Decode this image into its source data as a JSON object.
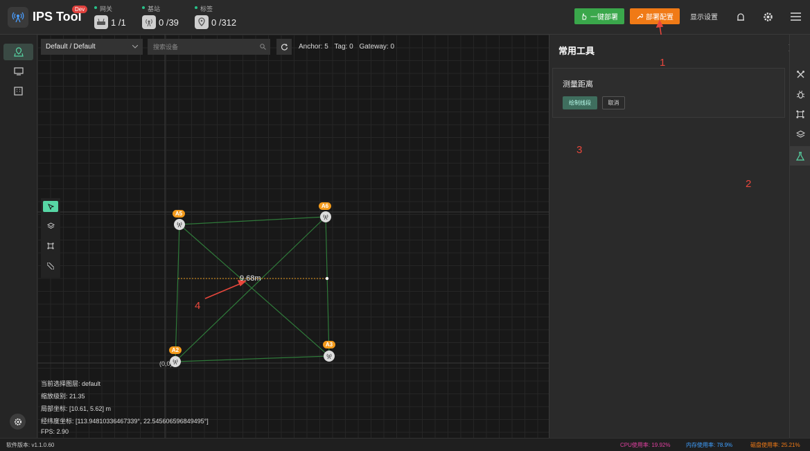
{
  "header": {
    "title": "IPS Tool",
    "badge": "Dev",
    "stats": [
      {
        "label": "网关",
        "value": "1 /1"
      },
      {
        "label": "基站",
        "value": "0 /39"
      },
      {
        "label": "标签",
        "value": "0 /312"
      }
    ],
    "buttons": {
      "deploy": "一键部署",
      "config": "部署配置",
      "display": "显示设置"
    }
  },
  "toolbar": {
    "select_value": "Default / Default",
    "search_placeholder": "搜索设备",
    "counts": {
      "anchor": "Anchor: 5",
      "tag": "Tag: 0",
      "gateway": "Gateway: 0"
    }
  },
  "canvas": {
    "anchors": [
      {
        "label": "A5"
      },
      {
        "label": "A6"
      },
      {
        "label": "A2"
      },
      {
        "label": "A3"
      }
    ],
    "origin_label": "(0,0)",
    "measure_label": "9.68m"
  },
  "info": {
    "layer": "当前选择图层: default",
    "zoom": "缩放级别: 21.35",
    "local": "局部坐标: [10.61, 5.62] m",
    "geo": "经纬度坐标: [113.94810336467339°, 22.545606596849495°]",
    "fps": "FPS: 2.90"
  },
  "panel": {
    "title": "常用工具",
    "card_title": "测量距离",
    "draw_button": "绘制线段",
    "cancel_button": "取消"
  },
  "annotations": [
    "1",
    "2",
    "3",
    "4"
  ],
  "footer": {
    "version": "软件版本: v1.1.0.60",
    "cpu": "CPU使用率: 19.92%",
    "mem": "内存使用率: 78.9%",
    "disk": "磁盘使用率: 25.21%"
  }
}
